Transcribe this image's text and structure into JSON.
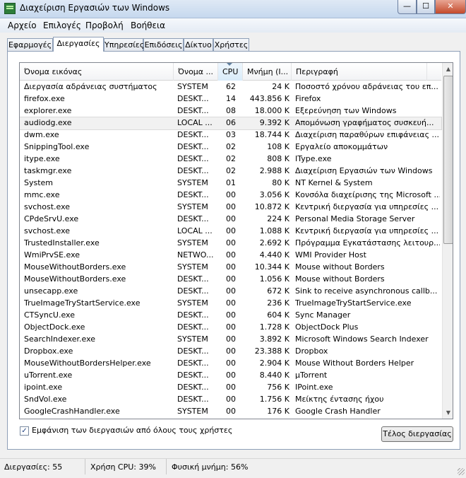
{
  "window": {
    "title": "Διαχείριση Εργασιών των Windows"
  },
  "titlebar": {
    "minimize": "—",
    "maximize": "☐",
    "close": "✕"
  },
  "menu": [
    "Αρχείο",
    "Επιλογές",
    "Προβολή",
    "Βοήθεια"
  ],
  "tabs": [
    "Εφαρμογές",
    "Διεργασίες",
    "Υπηρεσίες",
    "Επιδόσεις",
    "Δίκτυο",
    "Χρήστες"
  ],
  "active_tab": "Διεργασίες",
  "columns": [
    "Όνομα εικόνας",
    "Όνομα ...",
    "CPU",
    "Μνήμη (Ι...",
    "Περιγραφή"
  ],
  "sorted_column": "CPU",
  "processes": [
    {
      "name": "Διεργασία αδράνειας συστήματος",
      "user": "SYSTEM",
      "cpu": "62",
      "mem": "24 K",
      "desc": "Ποσοστό χρόνου αδράνειας του επ..."
    },
    {
      "name": "firefox.exe",
      "user": "DESKT...",
      "cpu": "14",
      "mem": "443.856 K",
      "desc": "Firefox"
    },
    {
      "name": "explorer.exe",
      "user": "DESKT...",
      "cpu": "08",
      "mem": "18.000 K",
      "desc": "Εξερεύνηση των Windows"
    },
    {
      "name": "audiodg.exe",
      "user": "LOCAL ...",
      "cpu": "06",
      "mem": "9.392 K",
      "desc": "Απομόνωση γραφήματος συσκευή..."
    },
    {
      "name": "dwm.exe",
      "user": "DESKT...",
      "cpu": "03",
      "mem": "18.744 K",
      "desc": "Διαχείριση παραθύρων επιφάνειας ..."
    },
    {
      "name": "SnippingTool.exe",
      "user": "DESKT...",
      "cpu": "02",
      "mem": "108 K",
      "desc": "Εργαλείο αποκομμάτων"
    },
    {
      "name": "itype.exe",
      "user": "DESKT...",
      "cpu": "02",
      "mem": "808 K",
      "desc": "IType.exe"
    },
    {
      "name": "taskmgr.exe",
      "user": "DESKT...",
      "cpu": "02",
      "mem": "2.988 K",
      "desc": "Διαχείριση Εργασιών των Windows"
    },
    {
      "name": "System",
      "user": "SYSTEM",
      "cpu": "01",
      "mem": "80 K",
      "desc": "NT Kernel & System"
    },
    {
      "name": "mmc.exe",
      "user": "DESKT...",
      "cpu": "00",
      "mem": "3.056 K",
      "desc": "Κονσόλα διαχείρισης της Microsoft ..."
    },
    {
      "name": "svchost.exe",
      "user": "SYSTEM",
      "cpu": "00",
      "mem": "10.872 K",
      "desc": "Κεντρική διεργασία για υπηρεσίες ..."
    },
    {
      "name": "CPdeSrvU.exe",
      "user": "DESKT...",
      "cpu": "00",
      "mem": "224 K",
      "desc": "Personal Media Storage Server"
    },
    {
      "name": "svchost.exe",
      "user": "LOCAL ...",
      "cpu": "00",
      "mem": "1.088 K",
      "desc": "Κεντρική διεργασία για υπηρεσίες ..."
    },
    {
      "name": "TrustedInstaller.exe",
      "user": "SYSTEM",
      "cpu": "00",
      "mem": "2.692 K",
      "desc": "Πρόγραμμα Εγκατάστασης λειτουρ..."
    },
    {
      "name": "WmiPrvSE.exe",
      "user": "NETWO...",
      "cpu": "00",
      "mem": "4.440 K",
      "desc": "WMI Provider Host"
    },
    {
      "name": "MouseWithoutBorders.exe",
      "user": "SYSTEM",
      "cpu": "00",
      "mem": "10.344 K",
      "desc": "Mouse without Borders"
    },
    {
      "name": "MouseWithoutBorders.exe",
      "user": "DESKT...",
      "cpu": "00",
      "mem": "1.056 K",
      "desc": "Mouse without Borders"
    },
    {
      "name": "unsecapp.exe",
      "user": "DESKT...",
      "cpu": "00",
      "mem": "672 K",
      "desc": "Sink to receive asynchronous callb..."
    },
    {
      "name": "TrueImageTryStartService.exe",
      "user": "SYSTEM",
      "cpu": "00",
      "mem": "236 K",
      "desc": "TrueImageTryStartService.exe"
    },
    {
      "name": "CTSyncU.exe",
      "user": "DESKT...",
      "cpu": "00",
      "mem": "604 K",
      "desc": "Sync Manager"
    },
    {
      "name": "ObjectDock.exe",
      "user": "DESKT...",
      "cpu": "00",
      "mem": "1.728 K",
      "desc": "ObjectDock Plus"
    },
    {
      "name": "SearchIndexer.exe",
      "user": "SYSTEM",
      "cpu": "00",
      "mem": "3.892 K",
      "desc": "Microsoft Windows Search Indexer"
    },
    {
      "name": "Dropbox.exe",
      "user": "DESKT...",
      "cpu": "00",
      "mem": "23.388 K",
      "desc": "Dropbox"
    },
    {
      "name": "MouseWithoutBordersHelper.exe",
      "user": "DESKT...",
      "cpu": "00",
      "mem": "2.904 K",
      "desc": "Mouse Without Borders Helper"
    },
    {
      "name": "uTorrent.exe",
      "user": "DESKT...",
      "cpu": "00",
      "mem": "8.440 K",
      "desc": "µTorrent"
    },
    {
      "name": "ipoint.exe",
      "user": "DESKT...",
      "cpu": "00",
      "mem": "756 K",
      "desc": "IPoint.exe"
    },
    {
      "name": "SndVol.exe",
      "user": "DESKT...",
      "cpu": "00",
      "mem": "1.756 K",
      "desc": "Μείκτης έντασης ήχου"
    },
    {
      "name": "GoogleCrashHandler.exe",
      "user": "SYSTEM",
      "cpu": "00",
      "mem": "176 K",
      "desc": "Google Crash Handler"
    }
  ],
  "selected_process": "audiodg.exe",
  "show_all_users": {
    "label": "Εμφάνιση των διεργασιών από όλους τους χρήστες",
    "checked": true
  },
  "end_process_button": "Τέλος διεργασίας",
  "status": {
    "processes": "Διεργασίες: 55",
    "cpu": "Χρήση CPU: 39%",
    "memory": "Φυσική μνήμη: 56%"
  }
}
